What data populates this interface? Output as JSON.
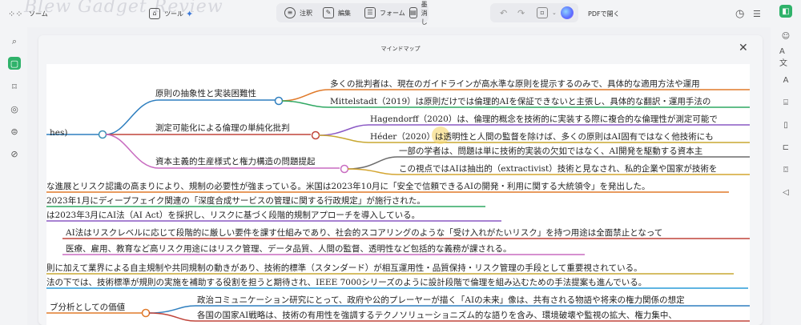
{
  "toolbar": {
    "watermark": "Blew Gadget Review",
    "left_label": "ソーム",
    "tool_label": "ツール",
    "comment_label": "注釈",
    "edit_label": "編集",
    "form_label": "フォーム",
    "cancel_label": "墨消し",
    "open_pdf_label": "PDFで開く"
  },
  "modal": {
    "title": "マインドマップ"
  },
  "mindmap": {
    "root_fragment": "hes)",
    "branches": [
      {
        "label": "原則の抽象性と実装困難性",
        "color": "#2f7fbf",
        "children": [
          "多くの批判者は、現在のガイドラインが高水準な原則を提示するのみで、具体的な適用方法や運用",
          "Mittelstadt（2019）は原則だけでは倫理的AIを保証できないと主張し、具体的な翻訳・運用手法の"
        ]
      },
      {
        "label": "測定可能化による倫理の単純化批判",
        "color": "#c0443a",
        "children": [
          "Hagendorff（2020）は、倫理的概念を技術的に実装する際に複合的な倫理性が測定可能で",
          "Héder（2020）は透明性と人間の監督を除けば、多くの原則はAI固有ではなく他技術にも"
        ]
      },
      {
        "label": "資本主義的生産様式と権力構造の問題提起",
        "color": "#c86cc0",
        "children": [
          "一部の学者は、問題は単に技術的実装の欠如ではなく、AI開発を駆動する資本主",
          "この視点ではAIは抽出的（extractivist）技術と見なされ、私的企業や国家が技術を"
        ]
      }
    ],
    "flat_lines": [
      "な進展とリスク認識の高まりにより、規制の必要性が強まっている。米国は2023年10月に「安全で信頼できるAIの開発・利用に関する大統領令」を発出した。",
      "2023年1月にディープフェイク関連の「深度合成サービスの管理に関する行政規定」が施行された。",
      "は2023年3月にAI法（AI Act）を採択し、リスクに基づく段階的規制アプローチを導入している。",
      "AI法はリスクレベルに応じて段階的に厳しい要件を課す仕組みであり、社会的スコアリングのような「受け入れがたいリスク」を持つ用途は全面禁止となって",
      "医療、雇用、教育など高リスク用途にはリスク管理、データ品質、人間の監督、透明性など包括的な義務が課される。",
      "則に加えて業界による自主規制や共同規制の動きがあり、技術的標準（スタンダード）が相互運用性・品質保持・リスク管理の手段として重要視されている。",
      "法の下では、技術標準が規則の実施を補助する役割を担うと期待され、IEEE 7000シリーズのように設計段階で倫理を組み込むための手法提案も進んでいる。"
    ],
    "bottom_branch": {
      "label": "ブ分析としての価値",
      "color": "#e07a2a",
      "children": [
        "政治コミュニケーション研究にとって、政府や公的プレーヤーが描く「AIの未来」像は、共有される物語や将来の権力関係の想定",
        "各国の国家AI戦略は、技術の有用性を強調するテクノソリューショニズム的な語りを含み、環境破壊や監視の拡大、権力集中、"
      ]
    }
  }
}
